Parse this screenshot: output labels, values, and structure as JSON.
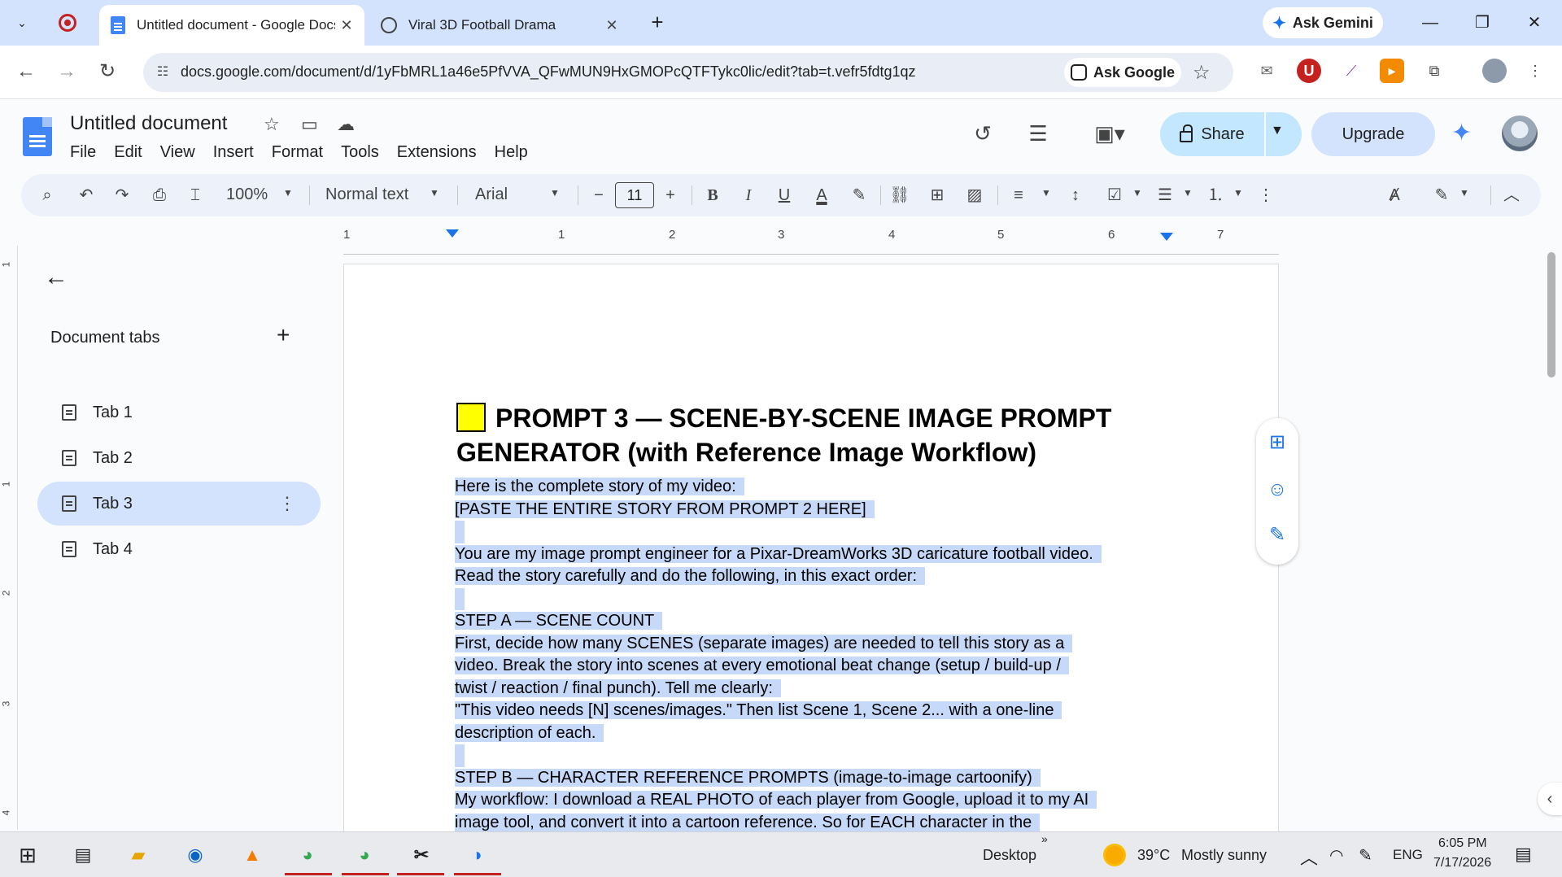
{
  "browser": {
    "tabs": [
      {
        "title": "Untitled document - Google Docs",
        "active": true
      },
      {
        "title": "Viral 3D Football Drama",
        "active": false
      }
    ],
    "ask_gemini": "Ask Gemini",
    "url": "docs.google.com/document/d/1yFbMRL1a46e5PfVVA_QFwMUN9HxGMOPcQTFTykc0lic/edit?tab=t.vefr5fdtg1qz",
    "ask_google": "Ask Google"
  },
  "docs": {
    "title": "Untitled document",
    "menu": [
      "File",
      "Edit",
      "View",
      "Insert",
      "Format",
      "Tools",
      "Extensions",
      "Help"
    ],
    "share_label": "Share",
    "upgrade_label": "Upgrade"
  },
  "toolbar": {
    "zoom": "100%",
    "style": "Normal text",
    "font": "Arial",
    "font_size": "11"
  },
  "ruler": {
    "h_numbers": [
      "1",
      "1",
      "2",
      "3",
      "4",
      "5",
      "6",
      "7"
    ],
    "v_numbers": [
      "1",
      "1",
      "2",
      "3",
      "4"
    ]
  },
  "sidebar": {
    "heading": "Document tabs",
    "tabs": [
      {
        "label": "Tab 1",
        "active": false
      },
      {
        "label": "Tab 2",
        "active": false
      },
      {
        "label": "Tab 3",
        "active": true
      },
      {
        "label": "Tab 4",
        "active": false
      }
    ]
  },
  "document": {
    "heading": "PROMPT 3 — SCENE-BY-SCENE IMAGE PROMPT GENERATOR (with Reference Image Workflow)",
    "lines": [
      "Here is the complete story of my video:",
      "[PASTE THE ENTIRE STORY FROM PROMPT 2 HERE]",
      "",
      "You are my image prompt engineer for a Pixar-DreamWorks 3D caricature football video.",
      "Read the story carefully and do the following, in this exact order:",
      "",
      "STEP A — SCENE COUNT",
      "First, decide how many SCENES (separate images) are needed to tell this story as a",
      "video. Break the story into scenes at every emotional beat change (setup / build-up /",
      "twist / reaction / final punch). Tell me clearly:",
      "\"This video needs [N] scenes/images.\" Then list Scene 1, Scene 2... with a one-line",
      "description of each.",
      "",
      "STEP B — CHARACTER REFERENCE PROMPTS (image-to-image cartoonify)",
      "My workflow: I download a REAL PHOTO of each player from Google, upload it to my AI",
      "image tool, and convert it into a cartoon reference. So for EACH character in the"
    ]
  },
  "taskbar": {
    "desktop_label": "Desktop",
    "weather_temp": "39°C",
    "weather_desc": "Mostly sunny",
    "lang": "ENG",
    "time": "6:05 PM",
    "date": "7/17/2026"
  },
  "colors": {
    "selection": "#c7d9f8",
    "share_button": "#c2e7ff",
    "accent": "#1a73e8"
  }
}
